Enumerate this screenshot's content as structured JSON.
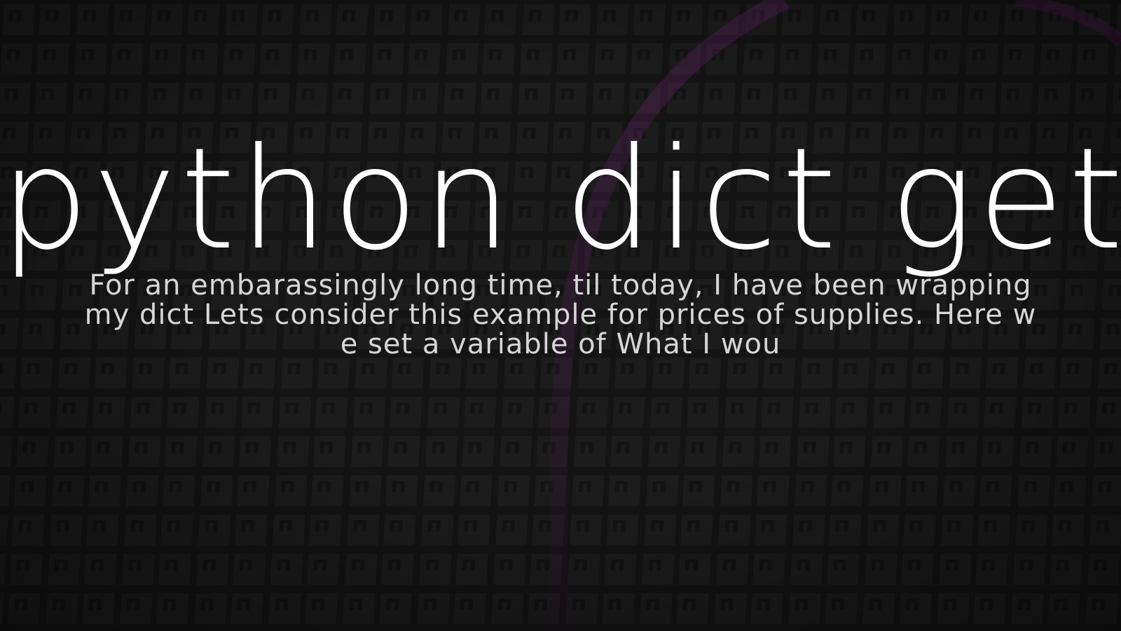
{
  "page": {
    "title": "python dict get",
    "description": "For an embarassingly long time, til today, I have been wrapping my dict Lets consider this example for prices of supplies.  Here we set a variable of What I wou"
  },
  "colors": {
    "background": "#161616",
    "tile": "#1f1f1f",
    "accent_glow": "#6b1f6e",
    "title_text": "#ffffff",
    "description_text": "#d6d6d6"
  }
}
